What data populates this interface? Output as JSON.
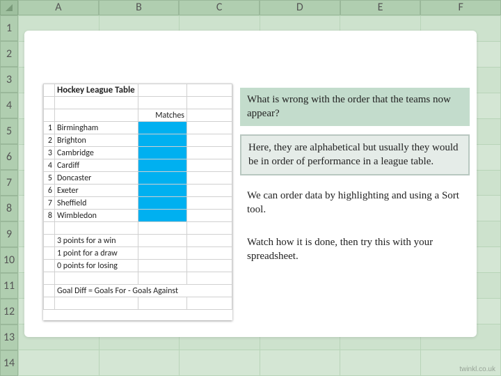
{
  "columns": [
    "A",
    "B",
    "C",
    "D",
    "E",
    "F"
  ],
  "rows": [
    "1",
    "2",
    "3",
    "4",
    "5",
    "6",
    "7",
    "8",
    "9",
    "10",
    "11",
    "12",
    "13",
    "14"
  ],
  "spreadsheet": {
    "title": "Hockey League Table",
    "matches_label": "Matches",
    "teams": [
      {
        "n": "1",
        "name": "Birmingham"
      },
      {
        "n": "2",
        "name": "Brighton"
      },
      {
        "n": "3",
        "name": "Cambridge"
      },
      {
        "n": "4",
        "name": "Cardiff"
      },
      {
        "n": "5",
        "name": "Doncaster"
      },
      {
        "n": "6",
        "name": "Exeter"
      },
      {
        "n": "7",
        "name": "Sheffield"
      },
      {
        "n": "8",
        "name": "Wimbledon"
      }
    ],
    "rules": [
      "3 points for a win",
      "1 point for a draw",
      "0 points for losing"
    ],
    "formula": "Goal Diff = Goals For - Goals Against"
  },
  "text": {
    "question": "What is wrong with the order that the teams now appear?",
    "answer": "Here, they are alphabetical but usually they would be in order of performance in a league table.",
    "instr1": "We can order data by highlighting and using a Sort tool.",
    "instr2": "Watch how it is done, then try this with your spreadsheet."
  },
  "watermark": "twinkl.co.uk"
}
